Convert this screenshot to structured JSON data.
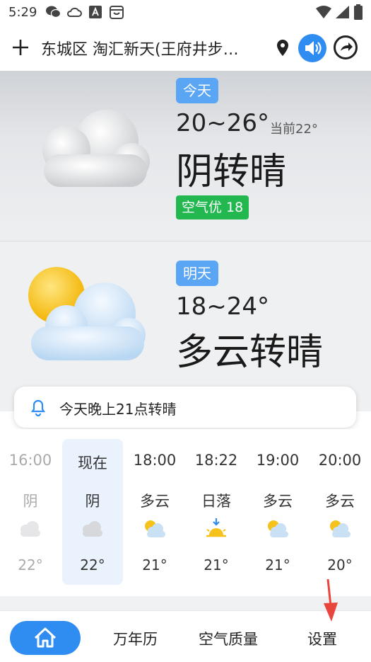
{
  "status_bar": {
    "time": "5:29"
  },
  "header": {
    "location": "东城区 淘汇新天(王府井步…"
  },
  "today": {
    "badge": "今天",
    "temp_range": "20~26°",
    "current": "当前22°",
    "condition": "阴转晴",
    "aqi": "空气优 18"
  },
  "tomorrow": {
    "badge": "明天",
    "temp_range": "18~24°",
    "condition": "多云转晴"
  },
  "notice": {
    "text": "今天晚上21点转晴"
  },
  "hourly": [
    {
      "time": "16:00",
      "cond": "阴",
      "temp": "22°",
      "icon": "cloud-icon"
    },
    {
      "time": "现在",
      "cond": "阴",
      "temp": "22°",
      "icon": "cloud-icon"
    },
    {
      "time": "18:00",
      "cond": "多云",
      "temp": "21°",
      "icon": "partly-cloudy-icon"
    },
    {
      "time": "18:22",
      "cond": "日落",
      "temp": "21°",
      "icon": "sunset-icon"
    },
    {
      "time": "19:00",
      "cond": "多云",
      "temp": "21°",
      "icon": "partly-cloudy-icon"
    },
    {
      "time": "20:00",
      "cond": "多云",
      "temp": "20°",
      "icon": "partly-cloudy-icon"
    }
  ],
  "nav": {
    "calendar": "万年历",
    "air_quality": "空气质量",
    "settings": "设置"
  },
  "colors": {
    "accent": "#2f8cf0",
    "aqi_good": "#22b84f",
    "badge": "#5aa6f4"
  }
}
